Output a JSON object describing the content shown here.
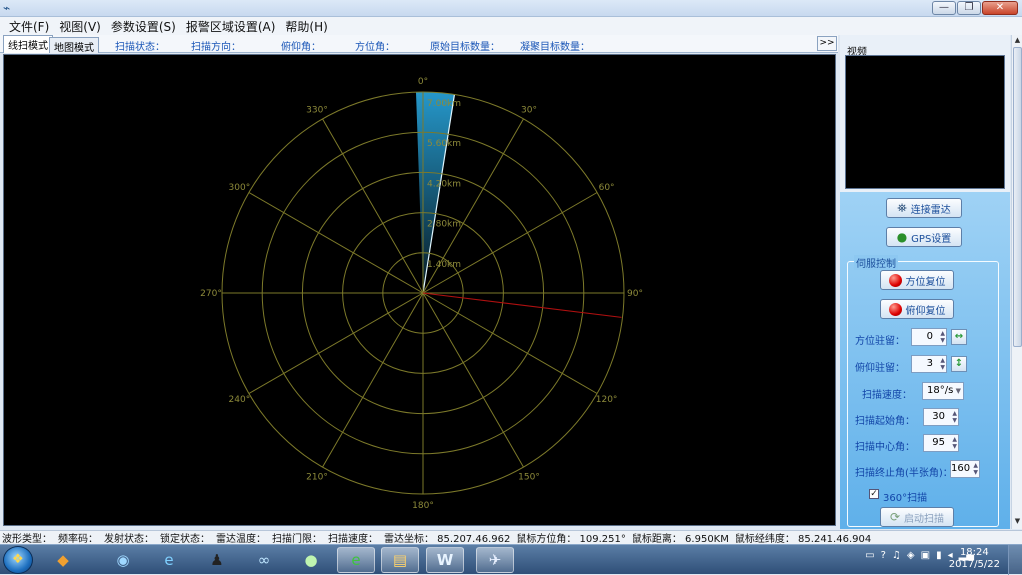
{
  "window": {
    "app_icon": "satellite-dish-icon",
    "minimize": "—",
    "maximize": "❐",
    "close": "✕"
  },
  "menu": [
    "文件(F)",
    "视图(V)",
    "参数设置(S)",
    "报警区域设置(A)",
    "帮助(H)"
  ],
  "tabs": {
    "scan_mode": "线扫模式",
    "map_mode": "地图模式"
  },
  "stats": {
    "scan_state": "扫描状态：",
    "scan_direction": "扫描方向：",
    "pitch": "俯仰角：",
    "azimuth": "方位角：",
    "raw_targets": "原始目标数量：",
    "clustered_targets": "凝聚目标数量："
  },
  "expand_button": ">>",
  "radar": {
    "angle_labels": [
      "0°",
      "30°",
      "60°",
      "90°",
      "120°",
      "150°",
      "180°",
      "210°",
      "240°",
      "270°",
      "300°",
      "330°"
    ],
    "range_labels": [
      "1.40km",
      "2.80km",
      "4.20km",
      "5.60km",
      "7.00km"
    ],
    "grid_color": "#7d7a2a",
    "sweep_color": "#2aa8e0",
    "bearing_color": "#b01010"
  },
  "panel": {
    "video_label": "视频",
    "connect_radar": "连接雷达",
    "gps_settings": "GPS设置",
    "servo_group": "伺服控制",
    "azimuth_reset": "方位复位",
    "pitch_reset": "俯仰复位",
    "azimuth_stay_label": "方位驻留：",
    "azimuth_stay_value": "0",
    "pitch_stay_label": "俯仰驻留：",
    "pitch_stay_value": "3",
    "scan_speed_label": "扫描速度：",
    "scan_speed_value": "18°/s",
    "scan_start_label": "扫描起始角：",
    "scan_start_value": "30",
    "scan_center_label": "扫描中心角：",
    "scan_center_value": "95",
    "scan_end_label": "扫描终止角(半张角)：",
    "scan_end_value": "160",
    "scan360_label": "360°扫描",
    "start_scan": "启动扫描"
  },
  "status": [
    "波形类型：",
    "频率码：",
    "发射状态：",
    "锁定状态：",
    "雷达温度：",
    "扫描门限：",
    "扫描速度：",
    "雷达坐标： 85.207.46.962",
    "鼠标方位角： 109.251°",
    "鼠标距离： 6.950KM",
    "鼠标经纬度： 85.241.46.904"
  ],
  "clock": {
    "time": "18:24",
    "date": "2017/5/22"
  }
}
